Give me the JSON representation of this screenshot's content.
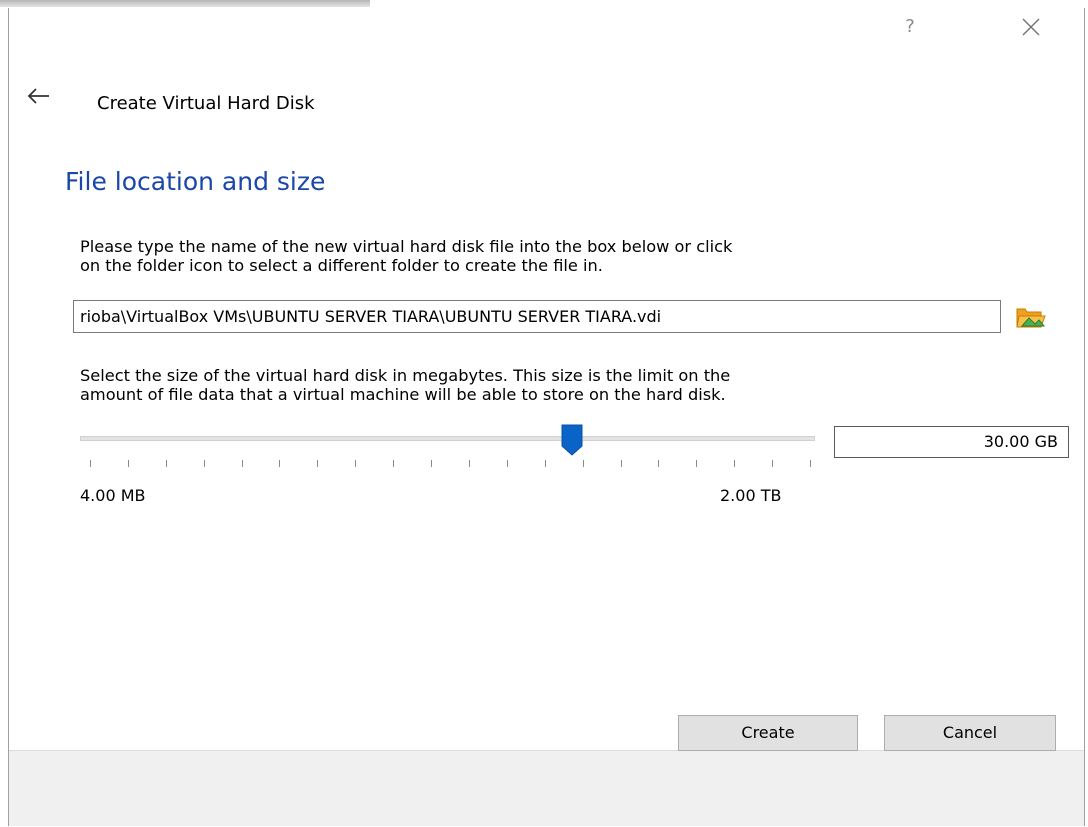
{
  "window": {
    "help_label": "?",
    "close_icon": "close-icon",
    "back_icon": "back-arrow-icon"
  },
  "wizard": {
    "title": "Create Virtual Hard Disk"
  },
  "page": {
    "heading": "File location and size",
    "location_description": "Please type the name of the new virtual hard disk file into the box below or click on the folder icon to select a different folder to create the file in.",
    "location_description_line1": "Please type the name of the new virtual hard disk file into the box below or click",
    "location_description_line2": "on the folder icon to select a different folder to create the file in.",
    "file_path_value": "rioba\\VirtualBox VMs\\UBUNTU SERVER TIARA\\UBUNTU SERVER TIARA.vdi",
    "folder_icon": "folder-icon",
    "size_description_line1": "Select the size of the virtual hard disk in megabytes. This size is the limit on the",
    "size_description_line2": "amount of file data that a virtual machine will be able to store on the hard disk.",
    "size_value": "30.00 GB",
    "slider_min_label": "4.00 MB",
    "slider_max_label": "2.00 TB",
    "slider_fraction": 0.67,
    "accent_color": "#1a47a8",
    "handle_color": "#0a64c8"
  },
  "footer": {
    "create_label": "Create",
    "cancel_label": "Cancel"
  }
}
